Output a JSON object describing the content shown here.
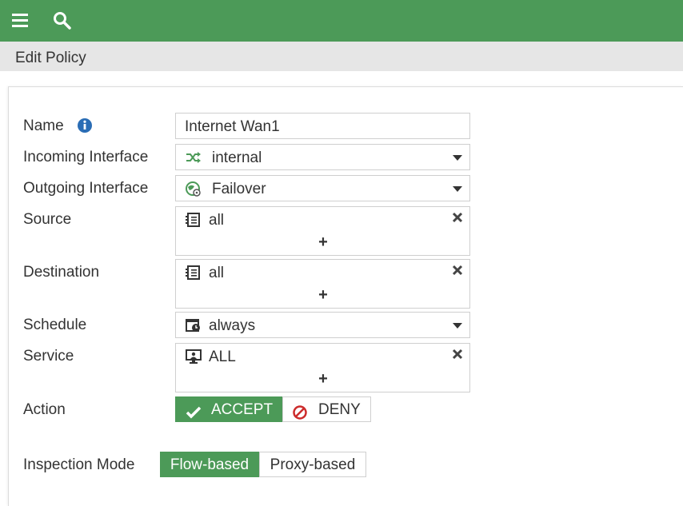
{
  "header": {
    "menu_icon": "hamburger-menu-icon",
    "search_icon": "search-icon"
  },
  "title": "Edit Policy",
  "form": {
    "name": {
      "label": "Name",
      "value": "Internet Wan1",
      "info_icon": "info-icon"
    },
    "incoming_interface": {
      "label": "Incoming Interface",
      "value": "internal",
      "icon": "shuffle-icon"
    },
    "outgoing_interface": {
      "label": "Outgoing Interface",
      "value": "Failover",
      "icon": "sdwan-icon"
    },
    "source": {
      "label": "Source",
      "value": "all",
      "icon": "address-icon"
    },
    "destination": {
      "label": "Destination",
      "value": "all",
      "icon": "address-icon"
    },
    "schedule": {
      "label": "Schedule",
      "value": "always",
      "icon": "schedule-icon"
    },
    "service": {
      "label": "Service",
      "value": "ALL",
      "icon": "service-icon"
    },
    "action": {
      "label": "Action",
      "options": [
        "ACCEPT",
        "DENY"
      ],
      "selected": "ACCEPT"
    },
    "inspection_mode": {
      "label": "Inspection Mode",
      "options": [
        "Flow-based",
        "Proxy-based"
      ],
      "selected": "Flow-based"
    }
  },
  "colors": {
    "accent": "#4c9a58",
    "header_bg": "#4c9a58",
    "titlebar_bg": "#e6e6e6",
    "deny_red": "#cc2b2b",
    "info_blue": "#2a6db5"
  },
  "plus_symbol": "+"
}
